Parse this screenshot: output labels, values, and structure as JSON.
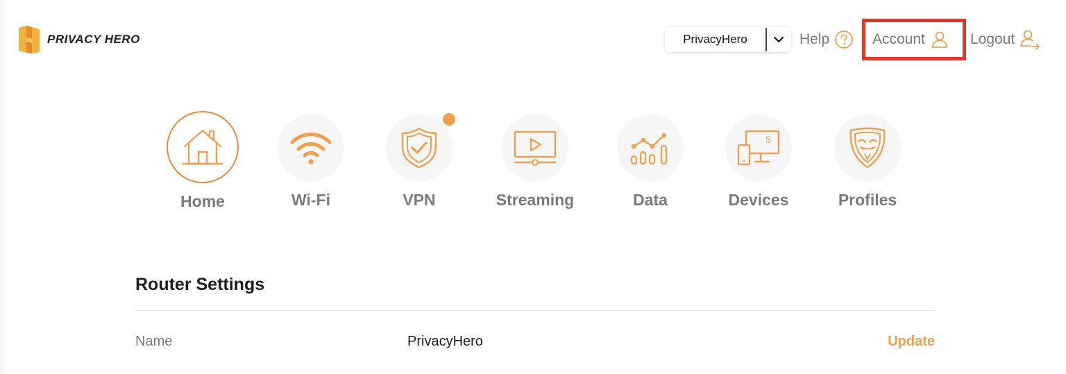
{
  "brand": {
    "name": "PRIVACY HERO",
    "accent_color": "#f0a04d",
    "logo_icon": "privacy-hero-logo"
  },
  "header": {
    "profile_selector": {
      "value": "PrivacyHero",
      "icon": "chevron-down-icon"
    },
    "help": {
      "label": "Help",
      "icon": "question-circle-icon"
    },
    "account": {
      "label": "Account",
      "icon": "user-icon",
      "highlight_color": "#e8362a"
    },
    "logout": {
      "label": "Logout",
      "icon": "user-logout-icon"
    }
  },
  "features": [
    {
      "label": "Home",
      "icon": "home-icon",
      "active": true
    },
    {
      "label": "Wi-Fi",
      "icon": "wifi-icon"
    },
    {
      "label": "VPN",
      "icon": "shield-check-icon",
      "notification": true
    },
    {
      "label": "Streaming",
      "icon": "play-screen-icon"
    },
    {
      "label": "Data",
      "icon": "data-chart-icon"
    },
    {
      "label": "Devices",
      "icon": "devices-icon",
      "badge": "5"
    },
    {
      "label": "Profiles",
      "icon": "mask-icon"
    }
  ],
  "router_settings": {
    "title": "Router Settings",
    "rows": [
      {
        "label": "Name",
        "value": "PrivacyHero",
        "action": "Update"
      }
    ]
  }
}
